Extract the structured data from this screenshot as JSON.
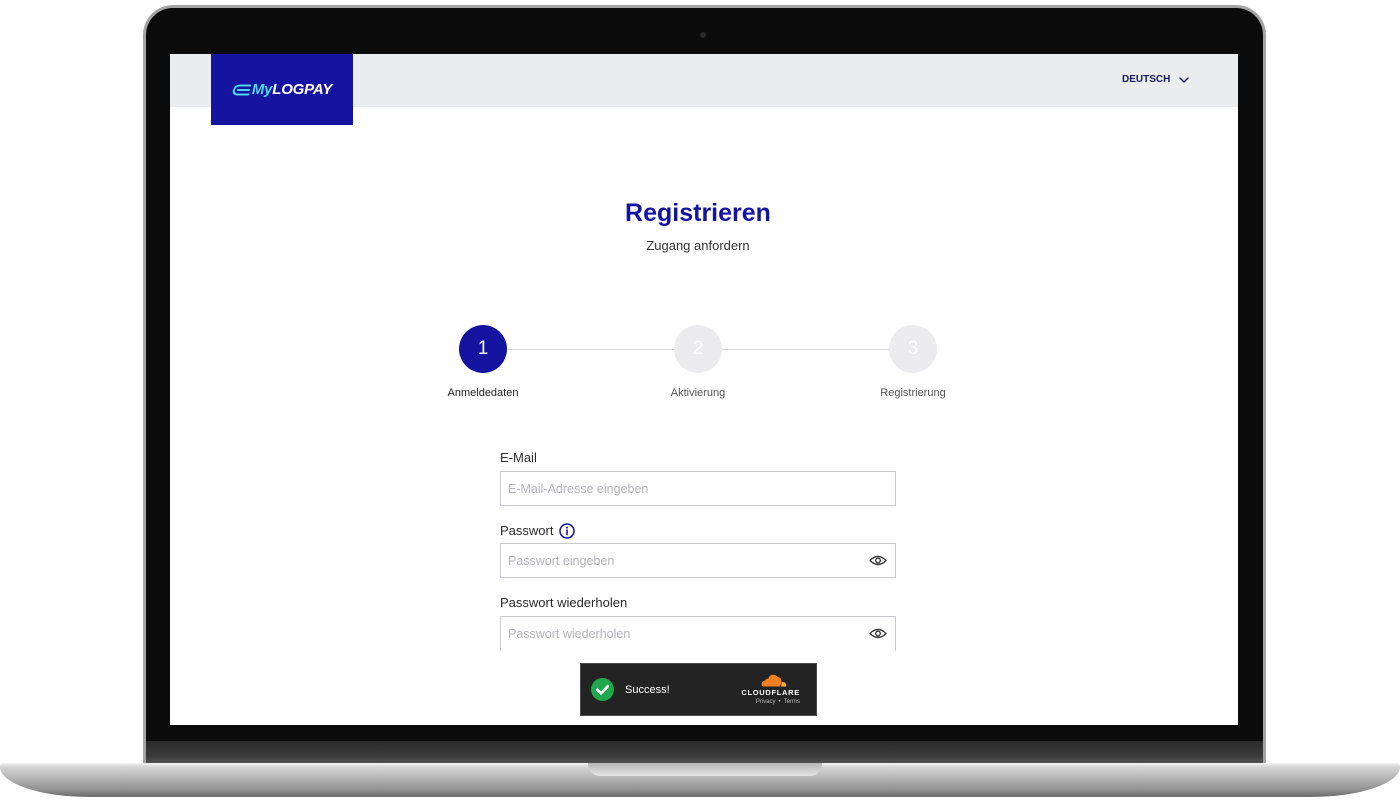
{
  "header": {
    "logo": {
      "prefix": "My",
      "name": "LOGPAY",
      "icon": "logo-swoosh-icon"
    },
    "language": {
      "label": "DEUTSCH",
      "icon": "chevron-down-icon"
    }
  },
  "page": {
    "title": "Registrieren",
    "subtitle": "Zugang anfordern"
  },
  "stepper": {
    "active": 1,
    "steps": [
      {
        "number": "1",
        "label": "Anmeldedaten"
      },
      {
        "number": "2",
        "label": "Aktivierung"
      },
      {
        "number": "3",
        "label": "Registrierung"
      }
    ]
  },
  "form": {
    "email": {
      "label": "E-Mail",
      "placeholder": "E-Mail-Adresse eingeben",
      "value": ""
    },
    "password": {
      "label": "Passwort",
      "placeholder": "Passwort eingeben",
      "value": "",
      "info_icon": "info-icon",
      "toggle_icon": "eye-icon"
    },
    "password_repeat": {
      "label": "Passwort wiederholen",
      "placeholder": "Passwort wiederholen",
      "value": "",
      "toggle_icon": "eye-icon"
    }
  },
  "captcha": {
    "status": "Success!",
    "status_icon": "check-circle-icon",
    "provider": "CLOUDFLARE",
    "provider_icon": "cloud-icon",
    "links": {
      "privacy": "Privacy",
      "separator": "•",
      "terms": "Terms"
    }
  },
  "colors": {
    "brand": "#1414a0",
    "accent": "#4fd6ee",
    "success": "#22a84c",
    "cf_orange": "#f38020",
    "cf_orange_light": "#fbad41"
  }
}
